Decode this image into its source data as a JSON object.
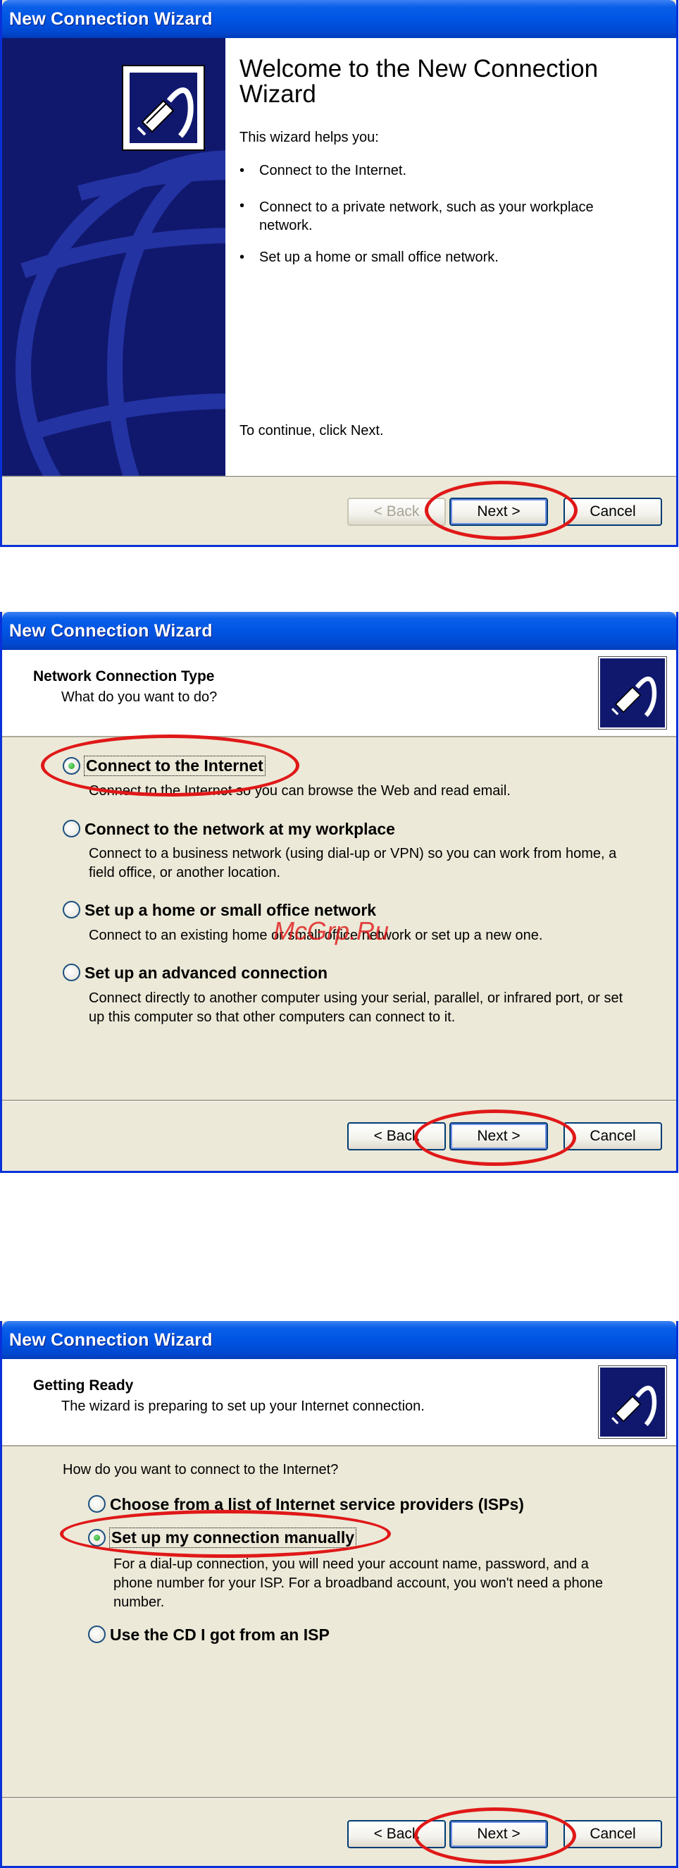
{
  "window1": {
    "title": "New Connection Wizard",
    "heading": "Welcome to the New Connection Wizard",
    "intro": "This wizard helps you:",
    "bullets": [
      "Connect to the Internet.",
      "Connect to a private network, such as your workplace network.",
      "Set up a home or small office network."
    ],
    "continue_text": "To continue, click Next.",
    "buttons": {
      "back": "< Back",
      "next": "Next >",
      "cancel": "Cancel"
    }
  },
  "window2": {
    "title": "New Connection Wizard",
    "header_title": "Network Connection Type",
    "header_subtitle": "What do you want to do?",
    "options": [
      {
        "label": "Connect to the Internet",
        "desc": "Connect to the Internet so you can browse the Web and read email.",
        "checked": true
      },
      {
        "label": "Connect to the network at my workplace",
        "desc": "Connect to a business network (using dial-up or VPN) so you can work from home, a field office, or another location.",
        "checked": false
      },
      {
        "label": "Set up a home or small office network",
        "desc": "Connect to an existing home or small office network or set up a new one.",
        "checked": false
      },
      {
        "label": "Set up an advanced connection",
        "desc": "Connect directly to another computer using your serial, parallel, or infrared port, or set up this computer so that other computers can connect to it.",
        "checked": false
      }
    ],
    "watermark": "McGrp.Ru",
    "buttons": {
      "back": "< Back",
      "next": "Next >",
      "cancel": "Cancel"
    }
  },
  "window3": {
    "title": "New Connection Wizard",
    "header_title": "Getting Ready",
    "header_subtitle": "The wizard is preparing to set up your Internet connection.",
    "question": "How do you want to connect to the Internet?",
    "options": [
      {
        "label": "Choose from a list of Internet service providers (ISPs)",
        "checked": false
      },
      {
        "label": "Set up my connection manually",
        "checked": true
      },
      {
        "label": "Use the CD I got from an ISP",
        "checked": false
      }
    ],
    "manual_desc": "For a dial-up connection, you will need your account name, password, and a phone number for your ISP. For a broadband account, you won't need a phone number.",
    "buttons": {
      "back": "< Back",
      "next": "Next >",
      "cancel": "Cancel"
    }
  },
  "colors": {
    "title_bar": "#0054e3",
    "dialog_bg": "#ece9d8",
    "annotation_ring": "#e01818",
    "side_panel": "#10186e"
  }
}
